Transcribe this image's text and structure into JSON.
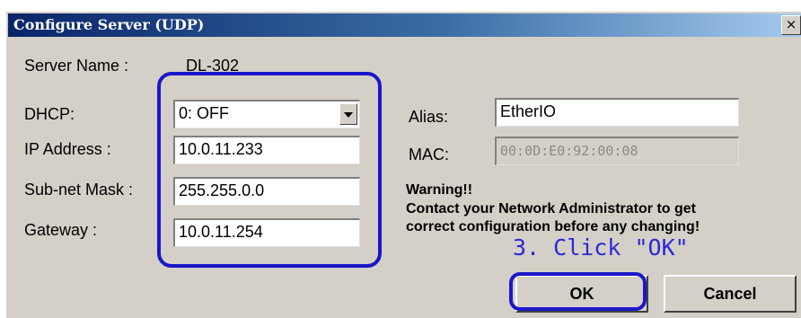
{
  "window": {
    "title": "Configure Server (UDP)",
    "close_glyph": "×"
  },
  "server": {
    "name_label": "Server Name :",
    "name_value": "DL-302"
  },
  "dhcp": {
    "label": "DHCP:",
    "value": "0: OFF"
  },
  "ip": {
    "label": "IP Address :",
    "value": "10.0.11.233"
  },
  "subnet": {
    "label": "Sub-net Mask :",
    "value": "255.255.0.0"
  },
  "gateway": {
    "label": "Gateway :",
    "value": "10.0.11.254"
  },
  "alias": {
    "label": "Alias:",
    "value": "EtherIO"
  },
  "mac": {
    "label": "MAC:",
    "value": "00:0D:E0:92:00:08"
  },
  "warning": {
    "title": "Warning!!",
    "line1": "Contact your Network Administrator to get",
    "line2": "correct  configuration before any changing!"
  },
  "annotation": {
    "text": "3. Click \"OK\"",
    "color": "#1a17c9"
  },
  "buttons": {
    "ok": "OK",
    "cancel": "Cancel"
  }
}
